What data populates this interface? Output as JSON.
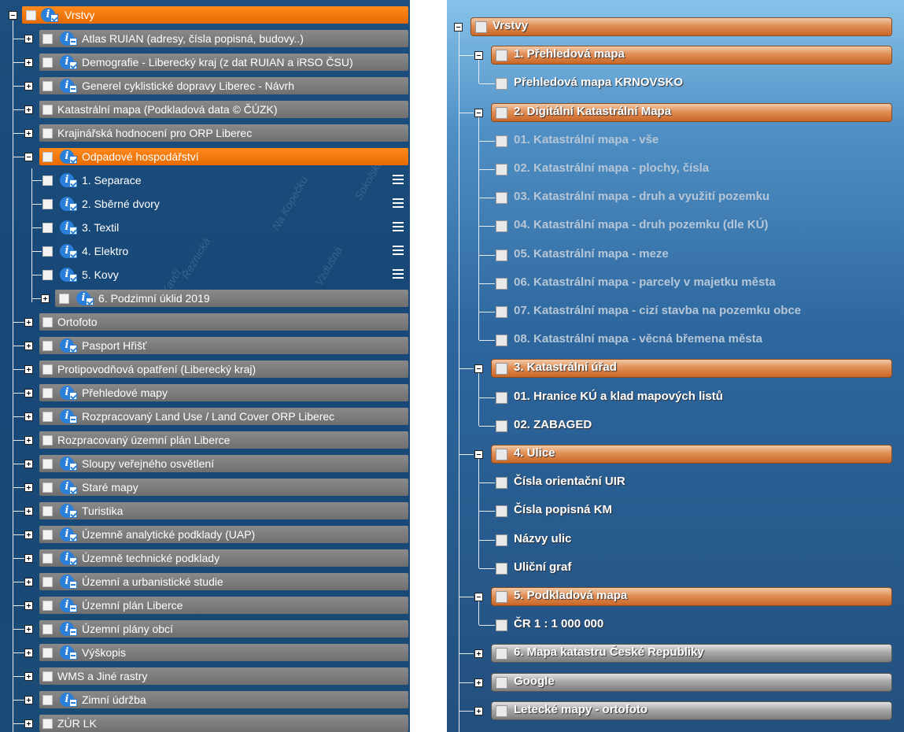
{
  "left_tree": {
    "root": {
      "label": "Vrstvy"
    },
    "items": [
      {
        "label": "Atlas RUIAN (adresy, čísla popisná, budovy..)",
        "info": "bar"
      },
      {
        "label": "Demografie - Liberecký kraj (z dat RUIAN a iRSO ČSU)",
        "info": "check"
      },
      {
        "label": "Generel cyklistické dopravy Liberec - Návrh",
        "info": "bar"
      },
      {
        "label": "Katastrální mapa (Podkladová data © ČÚZK)",
        "info": "none"
      },
      {
        "label": "Krajinářská hodnocení pro ORP Liberec",
        "info": "none"
      },
      {
        "label": "Odpadové hospodářství",
        "info": "check",
        "expanded": true,
        "children": [
          {
            "label": "1. Separace"
          },
          {
            "label": "2. Sběrné dvory"
          },
          {
            "label": "3. Textil"
          },
          {
            "label": "4. Elektro"
          },
          {
            "label": "5. Kovy"
          },
          {
            "label": "6. Podzimní úklid 2019"
          }
        ]
      },
      {
        "label": "Ortofoto",
        "info": "none"
      },
      {
        "label": "Pasport Hřišť",
        "info": "check"
      },
      {
        "label": "Protipovodňová opatření (Liberecký kraj)",
        "info": "none"
      },
      {
        "label": "Přehledové mapy",
        "info": "check"
      },
      {
        "label": "Rozpracovaný Land Use / Land Cover ORP Liberec",
        "info": "bar"
      },
      {
        "label": "Rozpracovaný územní plán Liberce",
        "info": "none"
      },
      {
        "label": "Sloupy veřejného osvětlení",
        "info": "check"
      },
      {
        "label": "Staré mapy",
        "info": "check"
      },
      {
        "label": "Turistika",
        "info": "check"
      },
      {
        "label": "Územně analytické podklady (UAP)",
        "info": "check"
      },
      {
        "label": "Územně technické podklady",
        "info": "check"
      },
      {
        "label": "Územní a urbanistické studie",
        "info": "bar"
      },
      {
        "label": "Územní plán Liberce",
        "info": "bar"
      },
      {
        "label": "Územní plány obcí",
        "info": "bar"
      },
      {
        "label": "Výškopis",
        "info": "bar"
      },
      {
        "label": "WMS a Jiné rastry",
        "info": "none"
      },
      {
        "label": "Zimní údržba",
        "info": "bar"
      },
      {
        "label": "ZÚR LK",
        "info": "none"
      }
    ],
    "map_bg": [
      "Na Kopečku",
      "Vzdušná",
      "Řeznická",
      "Kavčí",
      "Sokolská"
    ]
  },
  "right_tree": {
    "root": {
      "label": "Vrstvy"
    },
    "groups": [
      {
        "label": "1. Přehledová mapa",
        "children": [
          "Přehledová mapa KRNOVSKO"
        ],
        "dim": false
      },
      {
        "label": "2. Digitální Katastrální Mapa",
        "dim": true,
        "children": [
          "01. Katastrální mapa - vše",
          "02. Katastrální mapa - plochy, čísla",
          "03. Katastrální mapa - druh a využití pozemku",
          "04. Katastrální mapa - druh pozemku (dle KÚ)",
          "05. Katastrální mapa - meze",
          "06. Katastrální mapa - parcely v majetku města",
          "07. Katastrální mapa - cizí stavba na pozemku obce",
          "08. Katastrální mapa - věcná břemena města"
        ]
      },
      {
        "label": "3. Katastrální úřad",
        "dim": false,
        "children": [
          "01. Hranice KÚ a klad mapových listů",
          "02. ZABAGED"
        ]
      },
      {
        "label": "4. Ulice",
        "dim": false,
        "children": [
          "Čísla orientační UIR",
          "Čísla popisná KM",
          "Názvy ulic",
          "Uliční graf"
        ]
      },
      {
        "label": "5. Podkladová mapa",
        "dim": false,
        "children": [
          "ČR 1 : 1 000 000"
        ]
      }
    ],
    "collapsed": [
      "6. Mapa katastru České Republiky",
      "Google",
      "Letecké mapy - ortofoto"
    ]
  }
}
